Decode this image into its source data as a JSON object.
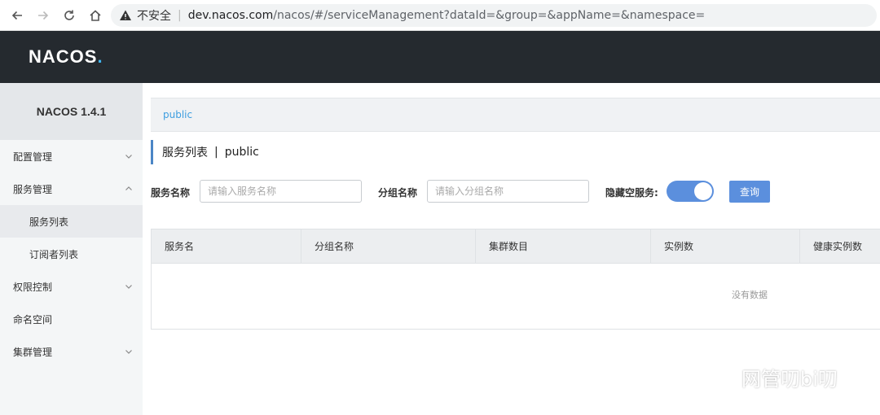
{
  "browser": {
    "insecure_label": "不安全",
    "separator": "|",
    "url_host": "dev.nacos.com",
    "url_path": "/nacos/#/serviceManagement?dataId=&group=&appName=&namespace="
  },
  "header": {
    "logo_main": "NACOS",
    "logo_dot": "."
  },
  "sidebar": {
    "title": "NACOS 1.4.1",
    "items": [
      {
        "label": "配置管理",
        "expanded": false
      },
      {
        "label": "服务管理",
        "expanded": true
      },
      {
        "label": "服务列表",
        "sub": true,
        "active": true
      },
      {
        "label": "订阅者列表",
        "sub": true
      },
      {
        "label": "权限控制",
        "expanded": false
      },
      {
        "label": "命名空间"
      },
      {
        "label": "集群管理",
        "expanded": false
      }
    ]
  },
  "namespace": {
    "current": "public"
  },
  "page": {
    "title": "服务列表",
    "separator": "|",
    "namespace": "public"
  },
  "filters": {
    "service_label": "服务名称",
    "service_placeholder": "请输入服务名称",
    "group_label": "分组名称",
    "group_placeholder": "请输入分组名称",
    "hide_empty_label": "隐藏空服务:",
    "hide_empty_on": true,
    "query_button": "查询"
  },
  "table": {
    "columns": [
      "服务名",
      "分组名称",
      "集群数目",
      "实例数",
      "健康实例数"
    ],
    "empty_text": "没有数据"
  },
  "watermark": {
    "text": "网管叨bi叨"
  },
  "colors": {
    "header_bg": "#252a2f",
    "accent": "#5b8fdd",
    "link": "#3d9ee0"
  }
}
